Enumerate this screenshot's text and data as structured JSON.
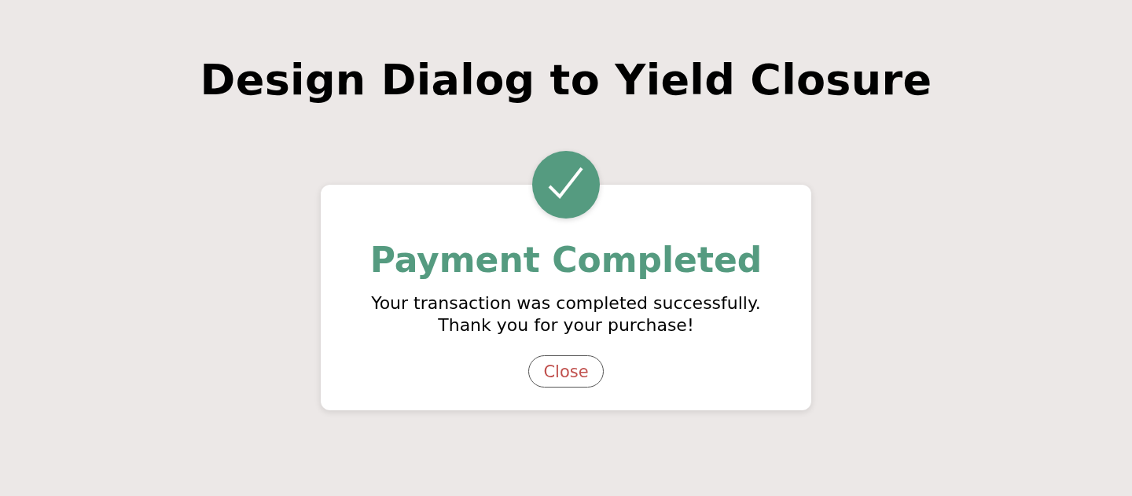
{
  "page": {
    "title": "Design Dialog to Yield Closure"
  },
  "dialog": {
    "heading": "Payment Completed",
    "message": "Your transaction was completed successfully.\nThank you for your purchase!",
    "button": {
      "label": "Close"
    }
  }
}
